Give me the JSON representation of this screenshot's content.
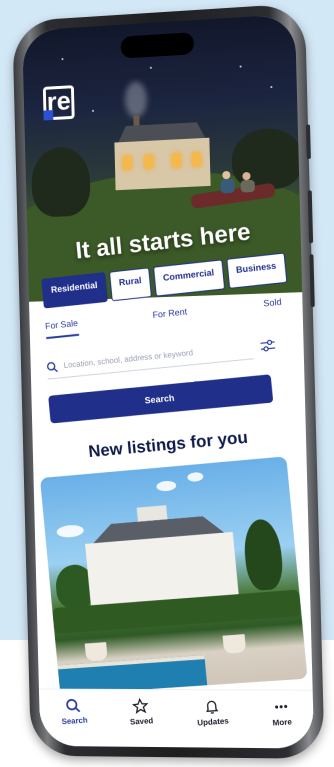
{
  "app": {
    "logo_text": "re"
  },
  "hero": {
    "headline": "It all starts here"
  },
  "categories": [
    {
      "label": "Residential",
      "active": true
    },
    {
      "label": "Rural",
      "active": false
    },
    {
      "label": "Commercial",
      "active": false
    },
    {
      "label": "Business",
      "active": false
    }
  ],
  "search_panel": {
    "tabs": [
      {
        "label": "For Sale",
        "active": true
      },
      {
        "label": "For Rent",
        "active": false
      },
      {
        "label": "Sold",
        "active": false
      }
    ],
    "search_placeholder": "Location, school, address or keyword",
    "search_button_label": "Search"
  },
  "listings_section": {
    "title": "New listings for you"
  },
  "bottom_nav": [
    {
      "label": "Search",
      "icon": "search-icon",
      "active": true
    },
    {
      "label": "Saved",
      "icon": "star-icon",
      "active": false
    },
    {
      "label": "Updates",
      "icon": "bell-icon",
      "active": false
    },
    {
      "label": "More",
      "icon": "more-icon",
      "active": false
    }
  ],
  "colors": {
    "brand_navy": "#1f2f8a",
    "accent_blue": "#2c4fd6",
    "background_light_blue": "#d3e8f7"
  }
}
